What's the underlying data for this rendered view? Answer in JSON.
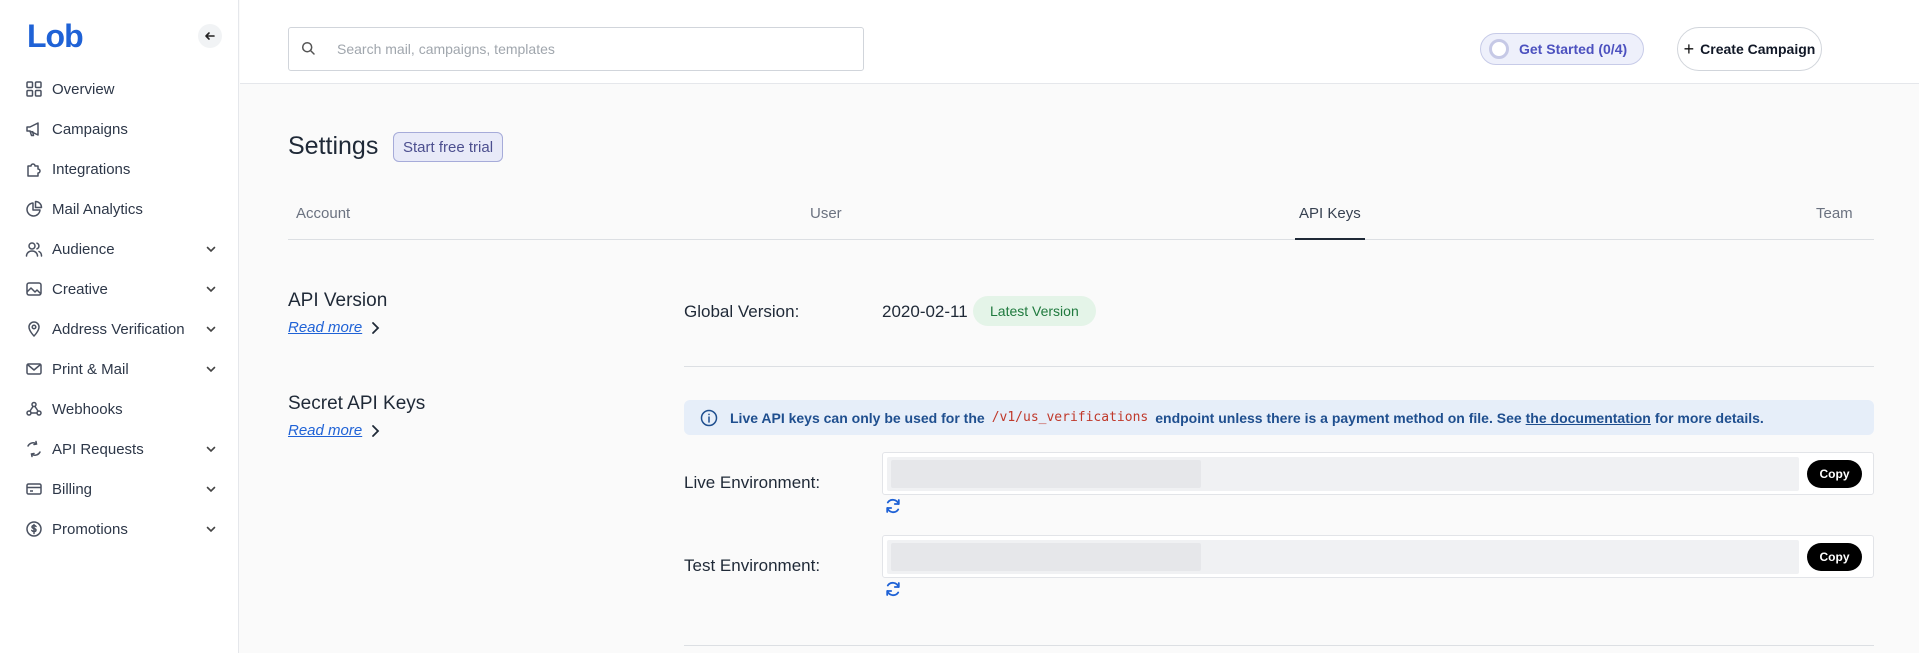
{
  "brand": {
    "logo_text": "Lob",
    "accent": "#1f62d6"
  },
  "sidebar": {
    "items": [
      {
        "label": "Overview",
        "icon": "grid-icon",
        "expandable": false
      },
      {
        "label": "Campaigns",
        "icon": "megaphone-icon",
        "expandable": false
      },
      {
        "label": "Integrations",
        "icon": "puzzle-icon",
        "expandable": false
      },
      {
        "label": "Mail Analytics",
        "icon": "pie-chart-icon",
        "expandable": false
      },
      {
        "label": "Audience",
        "icon": "users-icon",
        "expandable": true
      },
      {
        "label": "Creative",
        "icon": "image-icon",
        "expandable": true
      },
      {
        "label": "Address Verification",
        "icon": "location-pin-icon",
        "expandable": true
      },
      {
        "label": "Print & Mail",
        "icon": "envelope-icon",
        "expandable": true
      },
      {
        "label": "Webhooks",
        "icon": "webhook-icon",
        "expandable": false
      },
      {
        "label": "API Requests",
        "icon": "api-icon",
        "expandable": true
      },
      {
        "label": "Billing",
        "icon": "credit-card-icon",
        "expandable": true
      },
      {
        "label": "Promotions",
        "icon": "dollar-circle-icon",
        "expandable": true
      }
    ]
  },
  "topbar": {
    "search_placeholder": "Search mail, campaigns, templates",
    "get_started_label": "Get Started (0/4)",
    "create_campaign_label": "Create Campaign"
  },
  "page": {
    "title": "Settings",
    "trial_badge": "Start free trial",
    "tabs": [
      {
        "label": "Account",
        "active": false
      },
      {
        "label": "User",
        "active": false
      },
      {
        "label": "API Keys",
        "active": true
      },
      {
        "label": "Team",
        "active": false
      }
    ]
  },
  "api_version": {
    "title": "API Version",
    "read_more": "Read more",
    "global_label": "Global Version:",
    "global_value": "2020-02-11",
    "latest_badge": "Latest Version"
  },
  "secret_keys": {
    "title": "Secret API Keys",
    "read_more": "Read more",
    "banner_pre": "Live API keys can only be used for the",
    "banner_code": "/v1/us_verifications",
    "banner_mid": "endpoint unless there is a payment method on file. See",
    "banner_link": "the documentation",
    "banner_post": "for more details.",
    "live_label": "Live Environment:",
    "test_label": "Test Environment:",
    "copy_label": "Copy"
  }
}
